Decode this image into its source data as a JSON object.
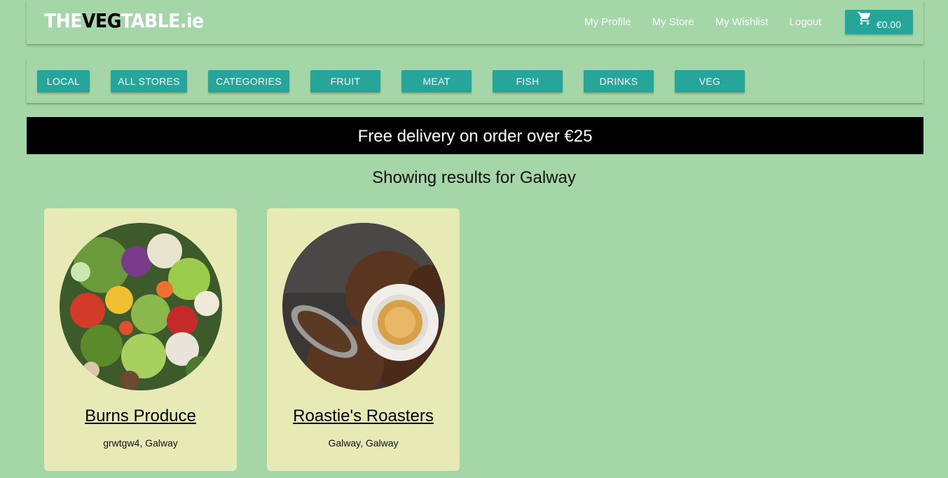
{
  "header": {
    "logo": {
      "part1": "THE",
      "part2": "VEG",
      "part3": "TABLE.ie"
    },
    "nav": [
      "My Profile",
      "My Store",
      "My Wishlist",
      "Logout"
    ],
    "cart": {
      "icon": "cart-icon",
      "total": "€0.00"
    }
  },
  "categories": [
    "LOCAL",
    "ALL STORES",
    "CATEGORIES",
    "FRUIT",
    "MEAT",
    "FISH",
    "DRINKS",
    "VEG"
  ],
  "banner": "Free delivery on order over €25",
  "results_heading": "Showing results for Galway",
  "stores": [
    {
      "name": "Burns Produce",
      "location": "grwtgw4, Galway"
    },
    {
      "name": "Roastie's Roasters",
      "location": "Galway, Galway"
    }
  ],
  "colors": {
    "background": "#a5d6a7",
    "button": "#26a69a",
    "banner": "#000000",
    "card": "#e8eab6"
  }
}
